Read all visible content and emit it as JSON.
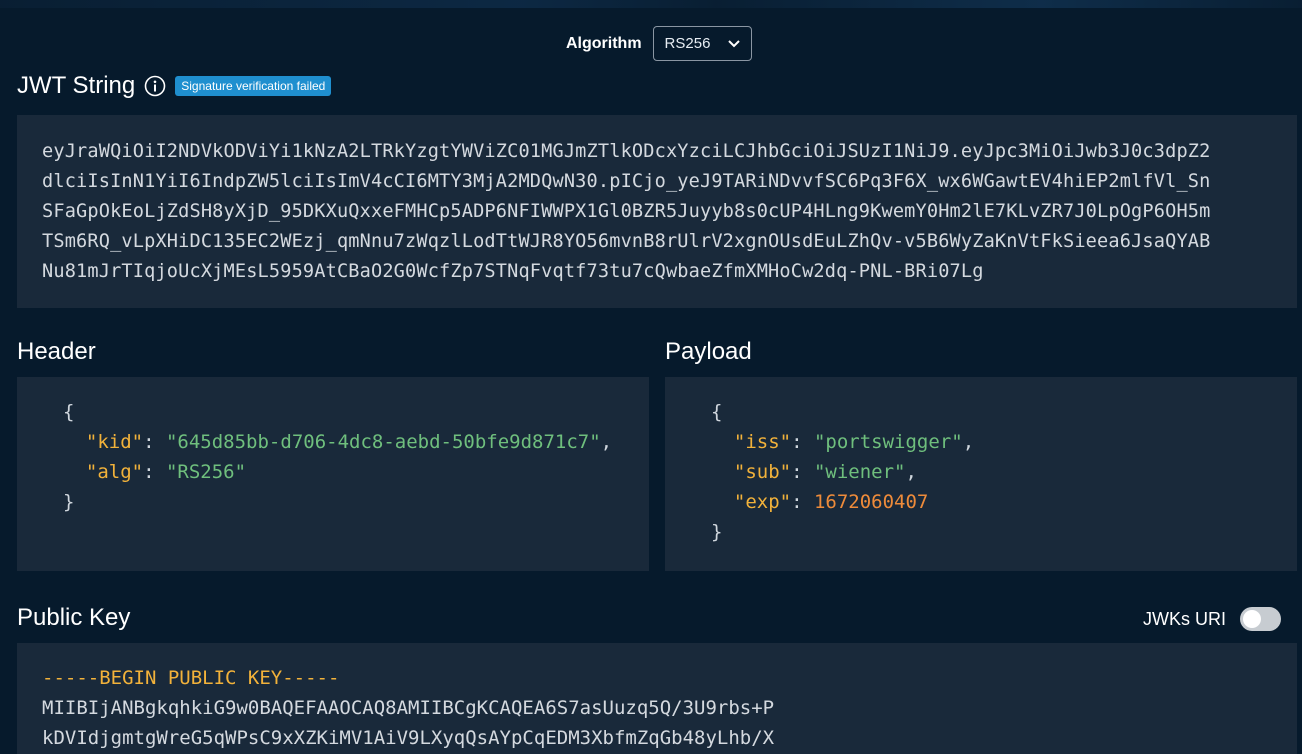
{
  "algorithm": {
    "label": "Algorithm",
    "selected": "RS256"
  },
  "jwt": {
    "title": "JWT String",
    "badge": "Signature verification failed",
    "lines": [
      "eyJraWQiOiI2NDVkODViYi1kNzA2LTRkYzgtYWViZC01MGJmZTlkODcxYzciLCJhbGciOiJSUzI1NiJ9.eyJpc3MiOiJwb3J0c3dpZ2",
      "dlciIsInN1YiI6IndpZW5lciIsImV4cCI6MTY3MjA2MDQwN30.pICjo_yeJ9TARiNDvvfSC6Pq3F6X_wx6WGawtEV4hiEP2mlfVl_Sn",
      "SFaGpOkEoLjZdSH8yXjD_95DKXuQxxeFMHCp5ADP6NFIWWPX1Gl0BZR5Juyyb8s0cUP4HLng9KwemY0Hm2lE7KLvZR7J0LpOgP6OH5m",
      "TSm6RQ_vLpXHiDC135EC2WEzj_qmNnu7zWqzlLodTtWJR8YO56mvnB8rUlrV2xgnOUsdEuLZhQv-v5B6WyZaKnVtFkSieea6JsaQYAB",
      "Nu81mJrTIqjoUcXjMEsL5959AtCBaO2G0WcfZp7STNqFvqtf73tu7cQwbaeZfmXMHoCw2dq-PNL-BRi07Lg"
    ]
  },
  "header": {
    "title": "Header",
    "open": "{",
    "close": "}",
    "fields": [
      {
        "key": "\"kid\"",
        "value": "\"645d85bb-d706-4dc8-aebd-50bfe9d871c7\"",
        "comma": ","
      },
      {
        "key": "\"alg\"",
        "value": "\"RS256\"",
        "comma": ""
      }
    ]
  },
  "payload": {
    "title": "Payload",
    "open": "{",
    "close": "}",
    "fields": [
      {
        "key": "\"iss\"",
        "value": "\"portswigger\"",
        "comma": ","
      },
      {
        "key": "\"sub\"",
        "value": "\"wiener\"",
        "comma": ","
      },
      {
        "key": "\"exp\"",
        "value": "1672060407",
        "comma": ""
      }
    ]
  },
  "public_key": {
    "title": "Public Key",
    "jwks_label": "JWKs URI",
    "jwks_enabled": false,
    "lines": [
      "-----BEGIN PUBLIC KEY-----",
      "MIIBIjANBgkqhkiG9w0BAQEFAAOCAQ8AMIIBCgKCAQEA6S7asUuzq5Q/3U9rbs+P",
      "kDVIdjgmtgWreG5qWPsC9xXZKiMV1AiV9LXyqQsAYpCqEDM3XbfmZqGb48yLhb/X"
    ]
  },
  "colors": {
    "background": "#061a2c",
    "panel": "#19293a",
    "key": "#f2b23a",
    "string": "#6fbf7d",
    "number": "#ee8b3a",
    "badge": "#1f8fcf"
  }
}
